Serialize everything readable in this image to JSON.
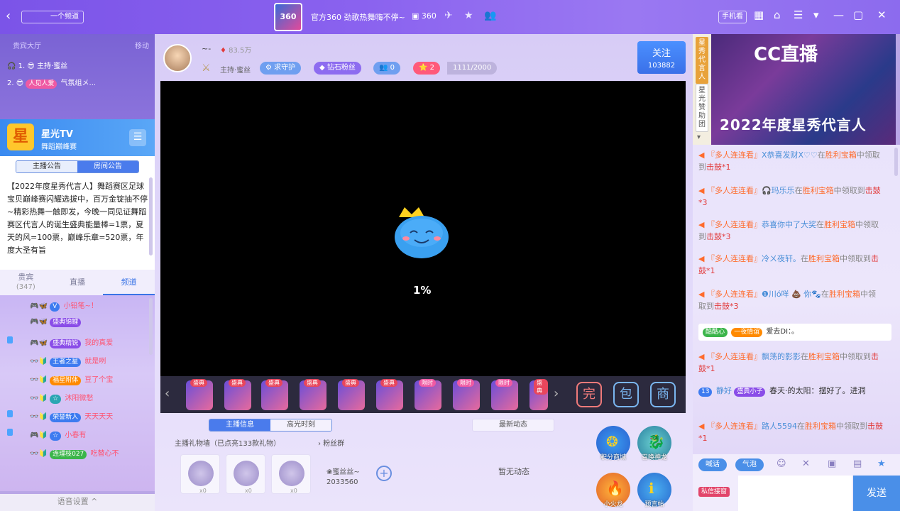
{
  "topbar": {
    "channel_btn": "一个频道",
    "room_title": "官方360 劲歌热舞嗨不停~",
    "room_id": "360",
    "logo_text": "360",
    "phone_watch": "手机看"
  },
  "ranking": {
    "header": "贵宾大厅",
    "right": "移动",
    "items": [
      {
        "rank": "1.",
        "name": "主持·蜜丝"
      },
      {
        "rank": "2.",
        "badge": "人见人爱",
        "name": "气氛组メ..."
      }
    ]
  },
  "channel_card": {
    "name": "星光TV",
    "sub": "舞蹈巅峰赛",
    "logo": "星"
  },
  "notice": {
    "tabs": [
      "主播公告",
      "房间公告"
    ],
    "text": "【2022年度星秀代言人】舞蹈赛区足球宝贝巅峰赛闪耀选拔中，百万金锭抽不停~精彩热舞一触即发，今晚一同见证舞蹈赛区代言人的诞生盛典能量棒=1票，夏天的风=100票，巅峰乐章=520票，年度大圣有旨"
  },
  "chat_tabs": [
    {
      "label": "贵宾",
      "count": "(347)"
    },
    {
      "label": "直播"
    },
    {
      "label": "频道"
    }
  ],
  "left_chat": [
    {
      "name": "小铅笔~！"
    },
    {
      "badge": "盛典锦鲤",
      "name": ""
    },
    {
      "badge": "盛典精锐",
      "name": "我的真爱"
    },
    {
      "badge": "王者之星",
      "name": "就是咧"
    },
    {
      "badge": "福星附体",
      "name": "豆了个宝"
    },
    {
      "badge": "",
      "name": "沐阳微愁"
    },
    {
      "badge": "荣誉新人",
      "name": "天天天天"
    },
    {
      "badge": "",
      "name": "小春有"
    },
    {
      "badge": "连理枝027",
      "name": "吃替心不"
    }
  ],
  "voice_settings": "语音设置",
  "anchor": {
    "nick": "~-",
    "hot": "83.5万",
    "host_tag": "主持·蜜丝",
    "guard": "求守护",
    "diamond_fans": "钻石粉丝",
    "fans_count": "0",
    "level": "2",
    "level_progress": "1111/2000",
    "follow": "关注",
    "follow_count": "103882"
  },
  "video": {
    "loading": "1%"
  },
  "gifts": {
    "items": [
      {
        "tag": "盛典"
      },
      {
        "tag": "盛典"
      },
      {
        "tag": "盛典"
      },
      {
        "tag": "盛典"
      },
      {
        "tag": "盛典"
      },
      {
        "tag": "盛典"
      },
      {
        "tag": "限时"
      },
      {
        "tag": "限时"
      },
      {
        "tag": "限时"
      },
      {
        "tag": "盛典"
      }
    ],
    "buttons": [
      "完",
      "包",
      "商"
    ]
  },
  "info": {
    "tabs": [
      "主播信息",
      "高光时刻"
    ],
    "gift_wall": "主播礼物墙（已点亮133款礼物）",
    "fans_group": "粉丝群",
    "gw_counts": [
      "x0",
      "x0",
      "x0"
    ],
    "fan_name": "❀蜜丝丝~",
    "fan_num": "2033560",
    "news_title": "最新动态",
    "no_news": "暂无动态"
  },
  "side_buttons": [
    {
      "label": "积分商城"
    },
    {
      "label": "召唤神龙"
    },
    {
      "label": "小火龙"
    },
    {
      "label": "预言帖"
    }
  ],
  "right": {
    "side_tabs": [
      "星秀代言人",
      "星光赞助团"
    ],
    "banner_logo": "CC直播",
    "banner_text": "2022年度星秀代言人",
    "messages": [
      {
        "pre": "『多人连连看』",
        "user": "X恭喜发财X♡♡",
        "mid": "在",
        "target": "胜利宝箱",
        "post": "中领取到",
        "item": "击鼓*1"
      },
      {
        "pre": "『多人连连看』",
        "user": "🎧玛乐乐",
        "mid": "在",
        "target": "胜利宝箱",
        "post": "中领取到",
        "item": "击鼓*3"
      },
      {
        "pre": "『多人连连看』",
        "user": "恭喜你中了大奖",
        "mid": "在",
        "target": "胜利宝箱",
        "post": "中领取到",
        "item": "击鼓*3"
      },
      {
        "pre": "『多人连连看』",
        "user": "冷ㄨ夜轩。",
        "mid": "在",
        "target": "胜利宝箱",
        "post": "中领取到",
        "item": "击鼓*1"
      },
      {
        "pre": "『多人连连看』",
        "user": "❶川ó咩 💩 你🐾",
        "mid": "在",
        "target": "胜利宝箱",
        "post": "中领取到",
        "item": "击鼓*3"
      },
      {
        "pre": "『多人连连看』",
        "user": "飘荡的影影",
        "mid": "在",
        "target": "胜利宝箱",
        "post": "中领取到",
        "item": "击鼓*1"
      },
      {
        "pre": "『多人连连看』",
        "user": "路人5594",
        "mid": "在",
        "target": "胜利宝箱",
        "post": "中领取到",
        "item": "击鼓*1"
      }
    ],
    "enter": {
      "badge1": "酷酷心",
      "badge2": "一夜情谊",
      "text": "爱去DI：。"
    },
    "user_msg": {
      "level": "13",
      "name": "静好",
      "badge": "盛典小子",
      "text": "春天·的太阳：摆好了。进洞"
    },
    "bottom_tabs": [
      "喊话",
      "气泡"
    ],
    "red_tag": "私信接窗",
    "send": "发送"
  }
}
